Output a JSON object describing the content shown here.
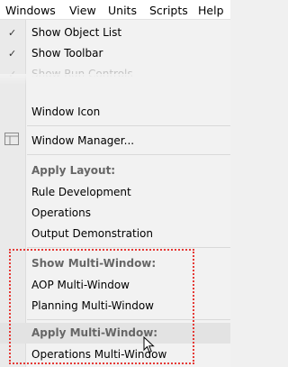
{
  "menubar": {
    "items": [
      "Windows",
      "View",
      "Units",
      "Scripts",
      "Help"
    ]
  },
  "menu": {
    "show_object_list": "Show Object List",
    "show_toolbar": "Show Toolbar",
    "show_run_controls": "Show Run Controls",
    "window_icon": "Window Icon",
    "window_manager": "Window Manager...",
    "apply_layout_header": "Apply Layout:",
    "layouts": [
      "Rule Development",
      "Operations",
      "Output Demonstration"
    ],
    "show_multi_header": "Show Multi-Window:",
    "multi_windows": [
      "AOP Multi-Window",
      "Planning Multi-Window"
    ],
    "apply_multi_header": "Apply Multi-Window:",
    "apply_multi_items": [
      "Operations Multi-Window"
    ]
  },
  "colors": {
    "highlight_border": "#e53935",
    "header_text": "#666666"
  },
  "icons": {
    "check": "check-icon",
    "window_manager": "window-layout-icon",
    "cursor": "mouse-pointer-icon"
  }
}
